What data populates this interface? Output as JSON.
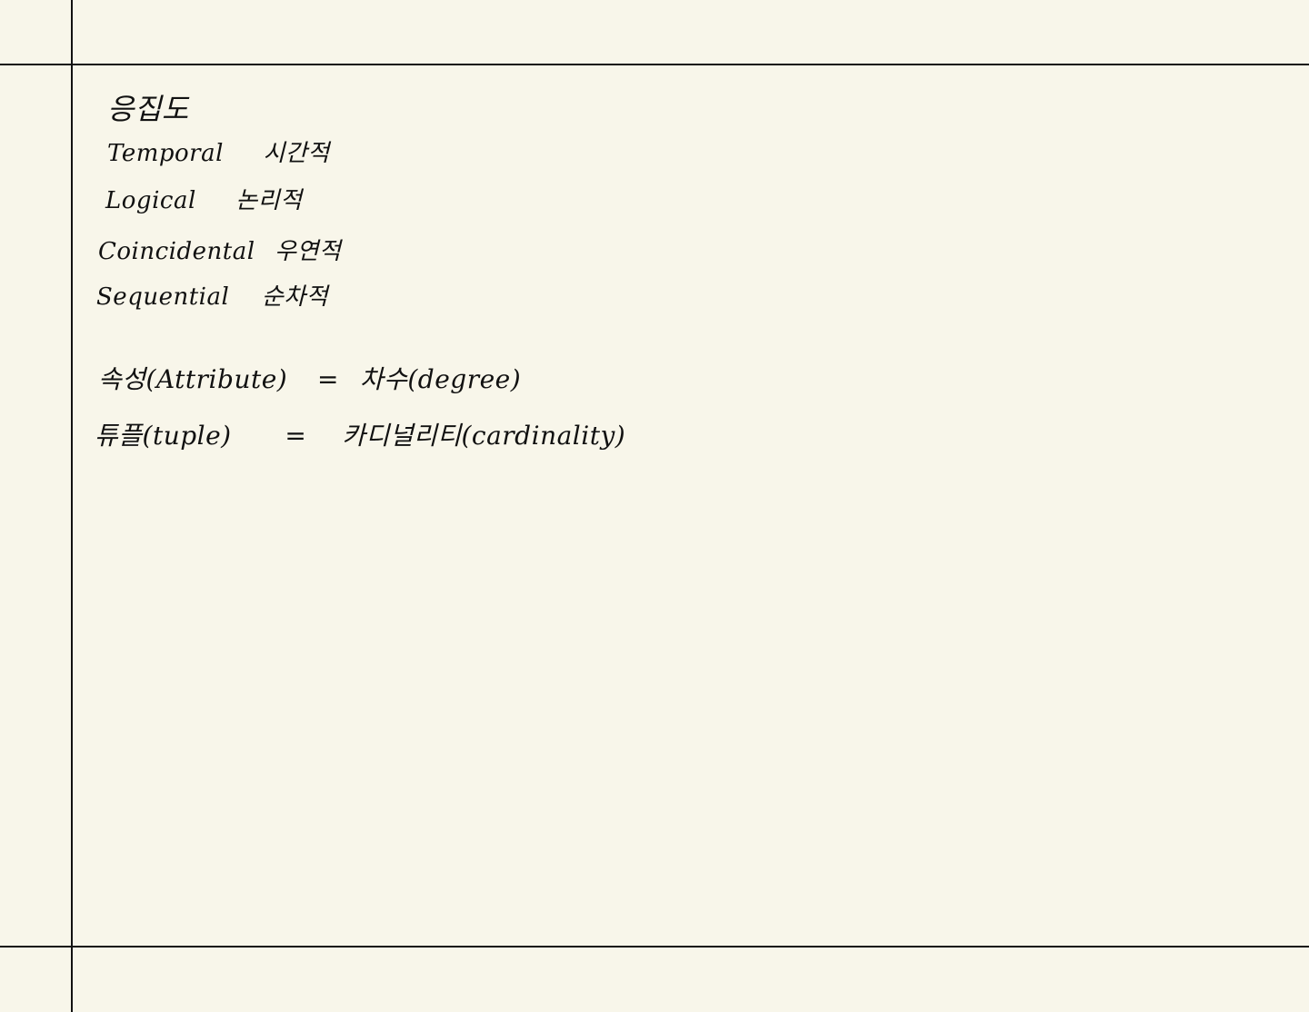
{
  "title": "응집도",
  "cohesion_types": [
    {
      "en": "Temporal",
      "ko": "시간적"
    },
    {
      "en": "Logical",
      "ko": "논리적"
    },
    {
      "en": "Coincidental",
      "ko": "우연적"
    },
    {
      "en": "Sequential",
      "ko": "순차적"
    }
  ],
  "equivalences": [
    {
      "left": "속성(Attribute)",
      "eq": "=",
      "right": "차수(degree)"
    },
    {
      "left": "튜플(tuple)",
      "eq": "=",
      "right": "카디널리티(cardinality)"
    }
  ]
}
